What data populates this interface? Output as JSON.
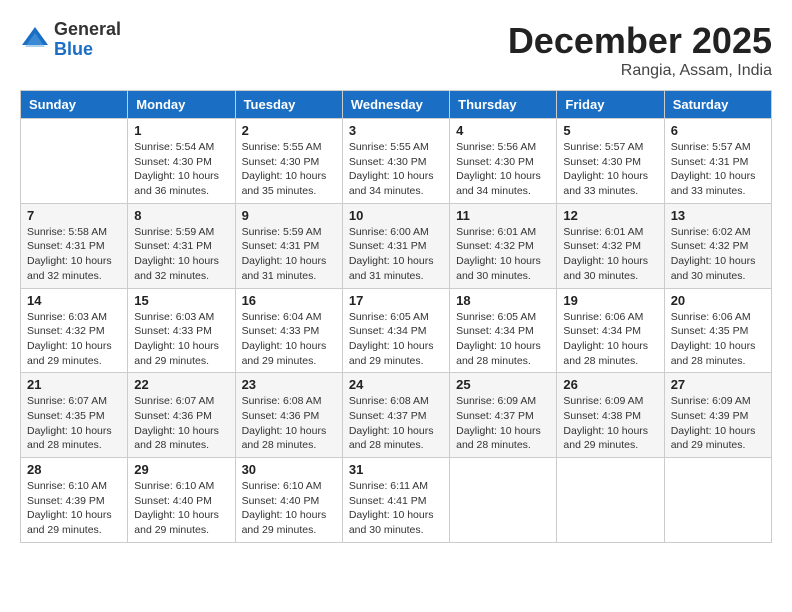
{
  "logo": {
    "general": "General",
    "blue": "Blue"
  },
  "title": "December 2025",
  "subtitle": "Rangia, Assam, India",
  "header_row": [
    "Sunday",
    "Monday",
    "Tuesday",
    "Wednesday",
    "Thursday",
    "Friday",
    "Saturday"
  ],
  "weeks": [
    [
      {
        "day": "",
        "info": ""
      },
      {
        "day": "1",
        "info": "Sunrise: 5:54 AM\nSunset: 4:30 PM\nDaylight: 10 hours\nand 36 minutes."
      },
      {
        "day": "2",
        "info": "Sunrise: 5:55 AM\nSunset: 4:30 PM\nDaylight: 10 hours\nand 35 minutes."
      },
      {
        "day": "3",
        "info": "Sunrise: 5:55 AM\nSunset: 4:30 PM\nDaylight: 10 hours\nand 34 minutes."
      },
      {
        "day": "4",
        "info": "Sunrise: 5:56 AM\nSunset: 4:30 PM\nDaylight: 10 hours\nand 34 minutes."
      },
      {
        "day": "5",
        "info": "Sunrise: 5:57 AM\nSunset: 4:30 PM\nDaylight: 10 hours\nand 33 minutes."
      },
      {
        "day": "6",
        "info": "Sunrise: 5:57 AM\nSunset: 4:31 PM\nDaylight: 10 hours\nand 33 minutes."
      }
    ],
    [
      {
        "day": "7",
        "info": "Sunrise: 5:58 AM\nSunset: 4:31 PM\nDaylight: 10 hours\nand 32 minutes."
      },
      {
        "day": "8",
        "info": "Sunrise: 5:59 AM\nSunset: 4:31 PM\nDaylight: 10 hours\nand 32 minutes."
      },
      {
        "day": "9",
        "info": "Sunrise: 5:59 AM\nSunset: 4:31 PM\nDaylight: 10 hours\nand 31 minutes."
      },
      {
        "day": "10",
        "info": "Sunrise: 6:00 AM\nSunset: 4:31 PM\nDaylight: 10 hours\nand 31 minutes."
      },
      {
        "day": "11",
        "info": "Sunrise: 6:01 AM\nSunset: 4:32 PM\nDaylight: 10 hours\nand 30 minutes."
      },
      {
        "day": "12",
        "info": "Sunrise: 6:01 AM\nSunset: 4:32 PM\nDaylight: 10 hours\nand 30 minutes."
      },
      {
        "day": "13",
        "info": "Sunrise: 6:02 AM\nSunset: 4:32 PM\nDaylight: 10 hours\nand 30 minutes."
      }
    ],
    [
      {
        "day": "14",
        "info": "Sunrise: 6:03 AM\nSunset: 4:32 PM\nDaylight: 10 hours\nand 29 minutes."
      },
      {
        "day": "15",
        "info": "Sunrise: 6:03 AM\nSunset: 4:33 PM\nDaylight: 10 hours\nand 29 minutes."
      },
      {
        "day": "16",
        "info": "Sunrise: 6:04 AM\nSunset: 4:33 PM\nDaylight: 10 hours\nand 29 minutes."
      },
      {
        "day": "17",
        "info": "Sunrise: 6:05 AM\nSunset: 4:34 PM\nDaylight: 10 hours\nand 29 minutes."
      },
      {
        "day": "18",
        "info": "Sunrise: 6:05 AM\nSunset: 4:34 PM\nDaylight: 10 hours\nand 28 minutes."
      },
      {
        "day": "19",
        "info": "Sunrise: 6:06 AM\nSunset: 4:34 PM\nDaylight: 10 hours\nand 28 minutes."
      },
      {
        "day": "20",
        "info": "Sunrise: 6:06 AM\nSunset: 4:35 PM\nDaylight: 10 hours\nand 28 minutes."
      }
    ],
    [
      {
        "day": "21",
        "info": "Sunrise: 6:07 AM\nSunset: 4:35 PM\nDaylight: 10 hours\nand 28 minutes."
      },
      {
        "day": "22",
        "info": "Sunrise: 6:07 AM\nSunset: 4:36 PM\nDaylight: 10 hours\nand 28 minutes."
      },
      {
        "day": "23",
        "info": "Sunrise: 6:08 AM\nSunset: 4:36 PM\nDaylight: 10 hours\nand 28 minutes."
      },
      {
        "day": "24",
        "info": "Sunrise: 6:08 AM\nSunset: 4:37 PM\nDaylight: 10 hours\nand 28 minutes."
      },
      {
        "day": "25",
        "info": "Sunrise: 6:09 AM\nSunset: 4:37 PM\nDaylight: 10 hours\nand 28 minutes."
      },
      {
        "day": "26",
        "info": "Sunrise: 6:09 AM\nSunset: 4:38 PM\nDaylight: 10 hours\nand 29 minutes."
      },
      {
        "day": "27",
        "info": "Sunrise: 6:09 AM\nSunset: 4:39 PM\nDaylight: 10 hours\nand 29 minutes."
      }
    ],
    [
      {
        "day": "28",
        "info": "Sunrise: 6:10 AM\nSunset: 4:39 PM\nDaylight: 10 hours\nand 29 minutes."
      },
      {
        "day": "29",
        "info": "Sunrise: 6:10 AM\nSunset: 4:40 PM\nDaylight: 10 hours\nand 29 minutes."
      },
      {
        "day": "30",
        "info": "Sunrise: 6:10 AM\nSunset: 4:40 PM\nDaylight: 10 hours\nand 29 minutes."
      },
      {
        "day": "31",
        "info": "Sunrise: 6:11 AM\nSunset: 4:41 PM\nDaylight: 10 hours\nand 30 minutes."
      },
      {
        "day": "",
        "info": ""
      },
      {
        "day": "",
        "info": ""
      },
      {
        "day": "",
        "info": ""
      }
    ]
  ]
}
